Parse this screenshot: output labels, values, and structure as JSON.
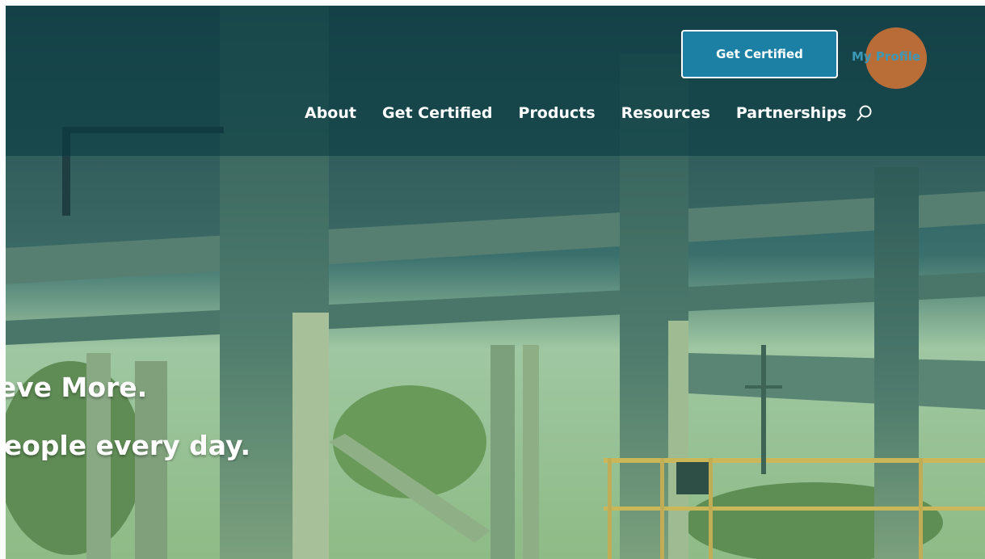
{
  "header": {
    "cta_label": "Get Certified",
    "profile_label": "My Profile",
    "nav": [
      {
        "label": "About"
      },
      {
        "label": "Get Certified"
      },
      {
        "label": "Products"
      },
      {
        "label": "Resources"
      },
      {
        "label": "Partnerships"
      }
    ],
    "search_icon": "search-icon"
  },
  "hero": {
    "headline_line1": "Certify. Achieve More.",
    "headline_line2": "Build safely, for people every day.",
    "overlay_color": "#0c5a66",
    "background": "construction-site-photo"
  },
  "colors": {
    "accent": "#1b80a3",
    "profile_link": "#3b98b6",
    "click_highlight": "#e87832"
  }
}
